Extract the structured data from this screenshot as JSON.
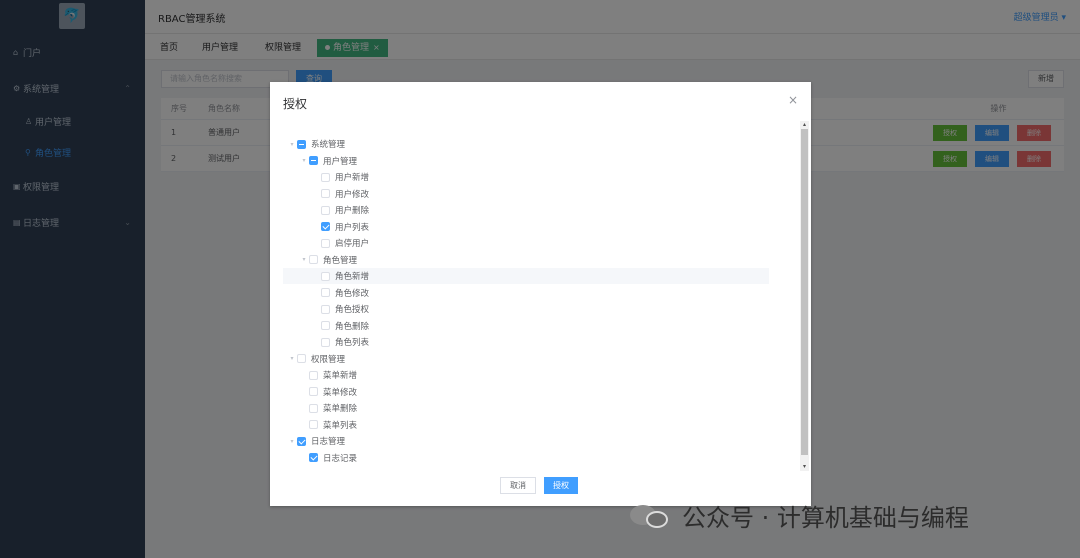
{
  "app": {
    "title": "RBAC管理系统",
    "user_menu": "超级管理员"
  },
  "sidebar": {
    "logo_icon": "dolphin-logo",
    "items": [
      {
        "label": "门户",
        "icon": "home-icon"
      },
      {
        "label": "系统管理",
        "icon": "gear-icon",
        "expanded": true
      },
      {
        "label": "用户管理",
        "icon": "user-icon"
      },
      {
        "label": "角色管理",
        "icon": "role-icon",
        "active": true
      },
      {
        "label": "权限管理",
        "icon": "lock-icon"
      },
      {
        "label": "日志管理",
        "icon": "log-icon"
      }
    ]
  },
  "tabs": [
    {
      "label": "首页"
    },
    {
      "label": "用户管理"
    },
    {
      "label": "权限管理"
    },
    {
      "label": "角色管理",
      "active": true
    }
  ],
  "toolbar": {
    "search_placeholder": "请输入角色名称搜索",
    "search_label": "查询",
    "add_label": "新增"
  },
  "table": {
    "headers": [
      "序号",
      "角色名称",
      "操作"
    ],
    "rows": [
      {
        "no": "1",
        "name": "普通用户"
      },
      {
        "no": "2",
        "name": "测试用户"
      }
    ],
    "actions": [
      "授权",
      "编辑",
      "删除"
    ]
  },
  "dialog": {
    "title": "授权",
    "close": "×",
    "cancel_label": "取消",
    "ok_label": "授权",
    "tree": [
      {
        "label": "系统管理",
        "level": 0,
        "state": "indeterminate",
        "caret": "▾"
      },
      {
        "label": "用户管理",
        "level": 1,
        "state": "indeterminate",
        "caret": "▾"
      },
      {
        "label": "用户新增",
        "level": 2,
        "state": "unchecked"
      },
      {
        "label": "用户修改",
        "level": 2,
        "state": "unchecked"
      },
      {
        "label": "用户删除",
        "level": 2,
        "state": "unchecked"
      },
      {
        "label": "用户列表",
        "level": 2,
        "state": "checked"
      },
      {
        "label": "启停用户",
        "level": 2,
        "state": "unchecked"
      },
      {
        "label": "角色管理",
        "level": 1,
        "state": "unchecked",
        "caret": "▾"
      },
      {
        "label": "角色新增",
        "level": 2,
        "state": "unchecked",
        "highlight": true
      },
      {
        "label": "角色修改",
        "level": 2,
        "state": "unchecked"
      },
      {
        "label": "角色授权",
        "level": 2,
        "state": "unchecked"
      },
      {
        "label": "角色删除",
        "level": 2,
        "state": "unchecked"
      },
      {
        "label": "角色列表",
        "level": 2,
        "state": "unchecked"
      },
      {
        "label": "权限管理",
        "level": 0,
        "state": "unchecked",
        "caret": "▾"
      },
      {
        "label": "菜单新增",
        "level": 1,
        "state": "unchecked"
      },
      {
        "label": "菜单修改",
        "level": 1,
        "state": "unchecked"
      },
      {
        "label": "菜单删除",
        "level": 1,
        "state": "unchecked"
      },
      {
        "label": "菜单列表",
        "level": 1,
        "state": "unchecked"
      },
      {
        "label": "日志管理",
        "level": 0,
        "state": "checked",
        "caret": "▾"
      },
      {
        "label": "日志记录",
        "level": 1,
        "state": "checked"
      }
    ]
  },
  "watermark": {
    "text": "公众号 · 计算机基础与编程",
    "icon": "wechat-icon"
  },
  "colors": {
    "sidebar_bg": "#304156",
    "primary": "#409eff",
    "tab_active": "#42b983",
    "success": "#67c23a",
    "danger": "#f56c6c"
  }
}
